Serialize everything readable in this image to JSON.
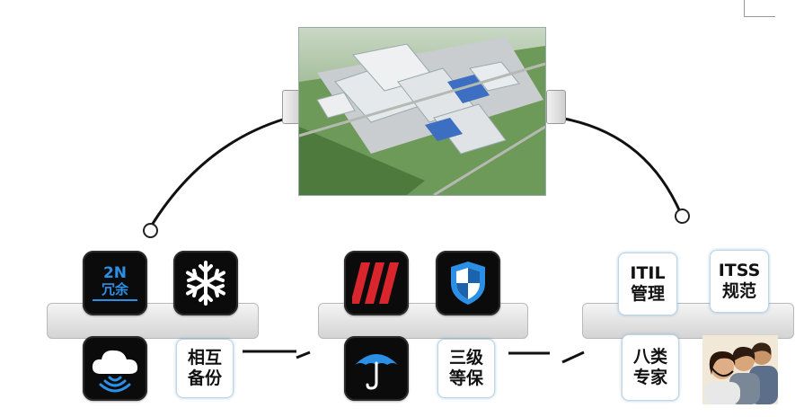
{
  "tiles": {
    "redundancy_line1": "2N",
    "redundancy_line2": "冗余"
  },
  "labels": {
    "mutual_backup": "相互\n备份",
    "level3_protection": "三级\n等保",
    "itil": "ITIL\n管理",
    "itss": "ITSS\n规范",
    "eight_experts": "八类\n专家"
  },
  "colors": {
    "tile_bg": "#0b0b0b",
    "accent_blue": "#2b8fe6",
    "stripe_red": "#d8262c",
    "bar_gray": "#d4d4d4"
  }
}
